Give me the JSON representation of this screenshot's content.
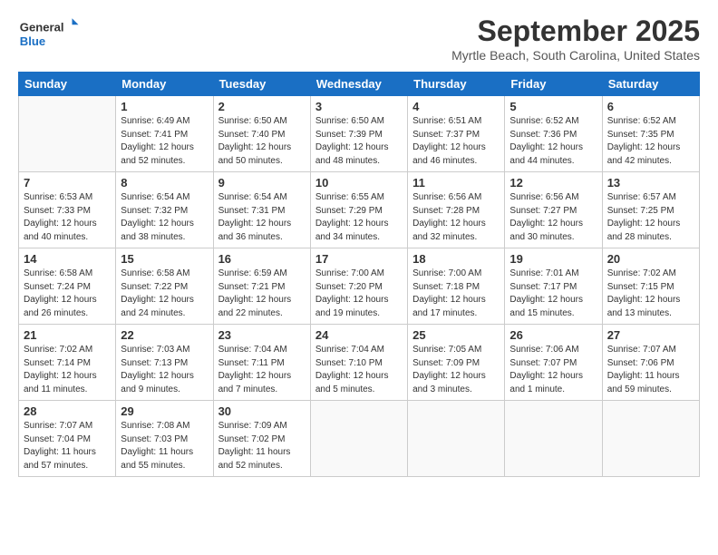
{
  "header": {
    "logo_line1": "General",
    "logo_line2": "Blue",
    "month_title": "September 2025",
    "subtitle": "Myrtle Beach, South Carolina, United States"
  },
  "days_of_week": [
    "Sunday",
    "Monday",
    "Tuesday",
    "Wednesday",
    "Thursday",
    "Friday",
    "Saturday"
  ],
  "weeks": [
    [
      {
        "day": "",
        "info": ""
      },
      {
        "day": "1",
        "info": "Sunrise: 6:49 AM\nSunset: 7:41 PM\nDaylight: 12 hours\nand 52 minutes."
      },
      {
        "day": "2",
        "info": "Sunrise: 6:50 AM\nSunset: 7:40 PM\nDaylight: 12 hours\nand 50 minutes."
      },
      {
        "day": "3",
        "info": "Sunrise: 6:50 AM\nSunset: 7:39 PM\nDaylight: 12 hours\nand 48 minutes."
      },
      {
        "day": "4",
        "info": "Sunrise: 6:51 AM\nSunset: 7:37 PM\nDaylight: 12 hours\nand 46 minutes."
      },
      {
        "day": "5",
        "info": "Sunrise: 6:52 AM\nSunset: 7:36 PM\nDaylight: 12 hours\nand 44 minutes."
      },
      {
        "day": "6",
        "info": "Sunrise: 6:52 AM\nSunset: 7:35 PM\nDaylight: 12 hours\nand 42 minutes."
      }
    ],
    [
      {
        "day": "7",
        "info": "Sunrise: 6:53 AM\nSunset: 7:33 PM\nDaylight: 12 hours\nand 40 minutes."
      },
      {
        "day": "8",
        "info": "Sunrise: 6:54 AM\nSunset: 7:32 PM\nDaylight: 12 hours\nand 38 minutes."
      },
      {
        "day": "9",
        "info": "Sunrise: 6:54 AM\nSunset: 7:31 PM\nDaylight: 12 hours\nand 36 minutes."
      },
      {
        "day": "10",
        "info": "Sunrise: 6:55 AM\nSunset: 7:29 PM\nDaylight: 12 hours\nand 34 minutes."
      },
      {
        "day": "11",
        "info": "Sunrise: 6:56 AM\nSunset: 7:28 PM\nDaylight: 12 hours\nand 32 minutes."
      },
      {
        "day": "12",
        "info": "Sunrise: 6:56 AM\nSunset: 7:27 PM\nDaylight: 12 hours\nand 30 minutes."
      },
      {
        "day": "13",
        "info": "Sunrise: 6:57 AM\nSunset: 7:25 PM\nDaylight: 12 hours\nand 28 minutes."
      }
    ],
    [
      {
        "day": "14",
        "info": "Sunrise: 6:58 AM\nSunset: 7:24 PM\nDaylight: 12 hours\nand 26 minutes."
      },
      {
        "day": "15",
        "info": "Sunrise: 6:58 AM\nSunset: 7:22 PM\nDaylight: 12 hours\nand 24 minutes."
      },
      {
        "day": "16",
        "info": "Sunrise: 6:59 AM\nSunset: 7:21 PM\nDaylight: 12 hours\nand 22 minutes."
      },
      {
        "day": "17",
        "info": "Sunrise: 7:00 AM\nSunset: 7:20 PM\nDaylight: 12 hours\nand 19 minutes."
      },
      {
        "day": "18",
        "info": "Sunrise: 7:00 AM\nSunset: 7:18 PM\nDaylight: 12 hours\nand 17 minutes."
      },
      {
        "day": "19",
        "info": "Sunrise: 7:01 AM\nSunset: 7:17 PM\nDaylight: 12 hours\nand 15 minutes."
      },
      {
        "day": "20",
        "info": "Sunrise: 7:02 AM\nSunset: 7:15 PM\nDaylight: 12 hours\nand 13 minutes."
      }
    ],
    [
      {
        "day": "21",
        "info": "Sunrise: 7:02 AM\nSunset: 7:14 PM\nDaylight: 12 hours\nand 11 minutes."
      },
      {
        "day": "22",
        "info": "Sunrise: 7:03 AM\nSunset: 7:13 PM\nDaylight: 12 hours\nand 9 minutes."
      },
      {
        "day": "23",
        "info": "Sunrise: 7:04 AM\nSunset: 7:11 PM\nDaylight: 12 hours\nand 7 minutes."
      },
      {
        "day": "24",
        "info": "Sunrise: 7:04 AM\nSunset: 7:10 PM\nDaylight: 12 hours\nand 5 minutes."
      },
      {
        "day": "25",
        "info": "Sunrise: 7:05 AM\nSunset: 7:09 PM\nDaylight: 12 hours\nand 3 minutes."
      },
      {
        "day": "26",
        "info": "Sunrise: 7:06 AM\nSunset: 7:07 PM\nDaylight: 12 hours\nand 1 minute."
      },
      {
        "day": "27",
        "info": "Sunrise: 7:07 AM\nSunset: 7:06 PM\nDaylight: 11 hours\nand 59 minutes."
      }
    ],
    [
      {
        "day": "28",
        "info": "Sunrise: 7:07 AM\nSunset: 7:04 PM\nDaylight: 11 hours\nand 57 minutes."
      },
      {
        "day": "29",
        "info": "Sunrise: 7:08 AM\nSunset: 7:03 PM\nDaylight: 11 hours\nand 55 minutes."
      },
      {
        "day": "30",
        "info": "Sunrise: 7:09 AM\nSunset: 7:02 PM\nDaylight: 11 hours\nand 52 minutes."
      },
      {
        "day": "",
        "info": ""
      },
      {
        "day": "",
        "info": ""
      },
      {
        "day": "",
        "info": ""
      },
      {
        "day": "",
        "info": ""
      }
    ]
  ]
}
